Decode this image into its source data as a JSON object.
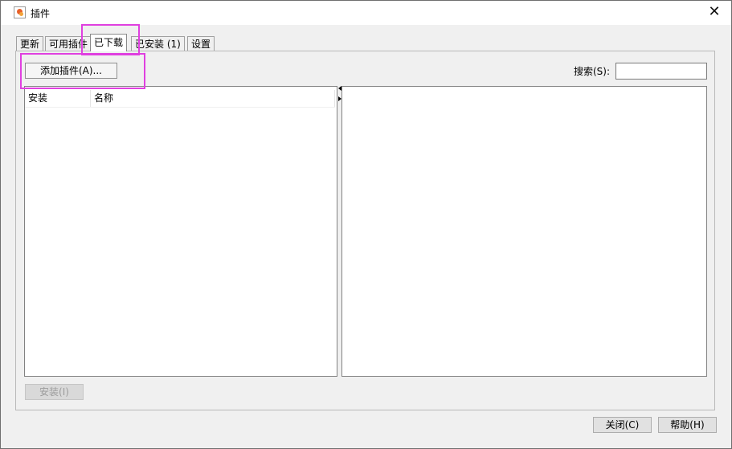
{
  "window": {
    "title": "插件",
    "close_glyph": "✕"
  },
  "tabs": [
    {
      "label": "更新"
    },
    {
      "label": "可用插件"
    },
    {
      "label": "已下载"
    },
    {
      "label": "已安装 (1)"
    },
    {
      "label": "设置"
    }
  ],
  "toolbar": {
    "add_plugin_label": "添加插件(A)..."
  },
  "search": {
    "label": "搜索(S):",
    "value": ""
  },
  "table": {
    "columns": [
      "安装",
      "名称"
    ]
  },
  "buttons": {
    "install_label": "安装(I)",
    "close_label": "关闭(C)",
    "help_label": "帮助(H)"
  }
}
